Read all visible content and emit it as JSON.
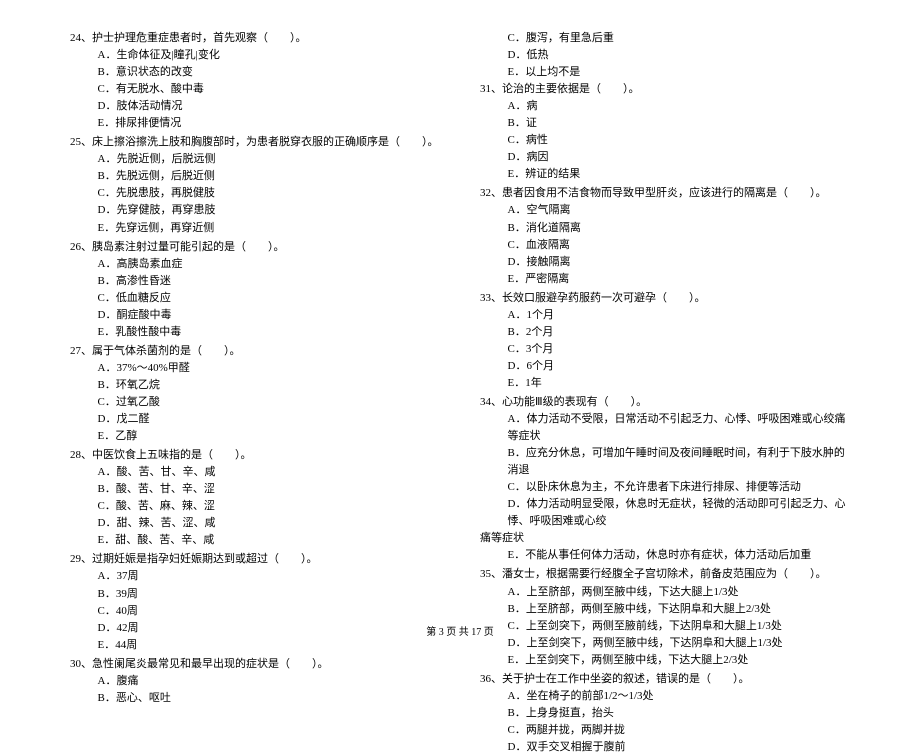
{
  "footer": "第 3 页 共 17 页",
  "left_column": [
    {
      "num": "24",
      "text": "护士护理危重症患者时，首先观察（　　）。",
      "options": [
        "A．生命体征及|瞳孔|变化",
        "B．意识状态的改变",
        "C．有无脱水、酸中毒",
        "D．肢体活动情况",
        "E．排尿排便情况"
      ]
    },
    {
      "num": "25",
      "text": "床上擦浴擦洗上肢和胸腹部时，为患者脱穿衣服的正确顺序是（　　）。",
      "options": [
        "A．先脱近侧，后脱远侧",
        "B．先脱远侧，后脱近侧",
        "C．先脱患肢，再脱健肢",
        "D．先穿健肢，再穿患肢",
        "E．先穿远侧，再穿近侧"
      ]
    },
    {
      "num": "26",
      "text": "胰岛素注射过量可能引起的是（　　）。",
      "options": [
        "A．高胰岛素血症",
        "B．高渗性昏迷",
        "C．低血糖反应",
        "D．酮症酸中毒",
        "E．乳酸性酸中毒"
      ]
    },
    {
      "num": "27",
      "text": "属于气体杀菌剂的是（　　）。",
      "options": [
        "A．37%～40%甲醛",
        "B．环氧乙烷",
        "C．过氧乙酸",
        "D．戊二醛",
        "E．乙醇"
      ]
    },
    {
      "num": "28",
      "text": "中医饮食上五味指的是（　　）。",
      "options": [
        "A．酸、苦、甘、辛、咸",
        "B．酸、苦、甘、辛、涩",
        "C．酸、苦、麻、辣、涩",
        "D．甜、辣、苦、涩、咸",
        "E．甜、酸、苦、辛、咸"
      ]
    },
    {
      "num": "29",
      "text": "过期妊娠是指孕妇妊娠期达到或超过（　　）。",
      "options": [
        "A．37周",
        "B．39周",
        "C．40周",
        "D．42周",
        "E．44周"
      ]
    },
    {
      "num": "30",
      "text": "急性阑尾炎最常见和最早出现的症状是（　　）。",
      "options": [
        "A．腹痛",
        "B．恶心、呕吐"
      ]
    }
  ],
  "right_column_pre": [
    "C．腹泻，有里急后重",
    "D．低热",
    "E．以上均不是"
  ],
  "right_column": [
    {
      "num": "31",
      "text": "论治的主要依据是（　　）。",
      "options": [
        "A．病",
        "B．证",
        "C．病性",
        "D．病因",
        "E．辨证的结果"
      ]
    },
    {
      "num": "32",
      "text": "患者因食用不洁食物而导致甲型肝炎，应该进行的隔离是（　　）。",
      "options": [
        "A．空气隔离",
        "B．消化道隔离",
        "C．血液隔离",
        "D．接触隔离",
        "E．严密隔离"
      ]
    },
    {
      "num": "33",
      "text": "长效口服避孕药服药一次可避孕（　　）。",
      "options": [
        "A．1个月",
        "B．2个月",
        "C．3个月",
        "D．6个月",
        "E．1年"
      ]
    },
    {
      "num": "34",
      "text": "心功能Ⅲ级的表现有（　　）。",
      "options": [
        "A．体力活动不受限，日常活动不引起乏力、心悸、呼吸困难或心绞痛等症状",
        "B．应充分休息，可增加午睡时间及夜间睡眠时间，有利于下肢水肿的消退",
        "C．以卧床休息为主，不允许患者下床进行排尿、排便等活动",
        "D．体力活动明显受限，休息时无症状，轻微的活动即可引起乏力、心悸、呼吸困难或心绞"
      ],
      "wrap_text": "痛等症状",
      "post_options": [
        "E．不能从事任何体力活动，休息时亦有症状，体力活动后加重"
      ]
    },
    {
      "num": "35",
      "text": "潘女士，根据需要行经腹全子宫切除术，前备皮范围应为（　　）。",
      "options": [
        "A．上至脐部，两侧至腋中线，下达大腿上1/3处",
        "B．上至脐部，两侧至腋中线，下达阴阜和大腿上2/3处",
        "C．上至剑突下，两侧至腋前线，下达阴阜和大腿上1/3处",
        "D．上至剑突下，两侧至腋中线，下达阴阜和大腿上1/3处",
        "E．上至剑突下，两侧至腋中线，下达大腿上2/3处"
      ]
    },
    {
      "num": "36",
      "text": "关于护士在工作中坐姿的叙述，错误的是（　　）。",
      "options": [
        "A．坐在椅子的前部1/2～1/3处",
        "B．上身身挺直，抬头",
        "C．两腿并拢，两脚并拢",
        "D．双手交叉相握于腹前"
      ]
    }
  ]
}
